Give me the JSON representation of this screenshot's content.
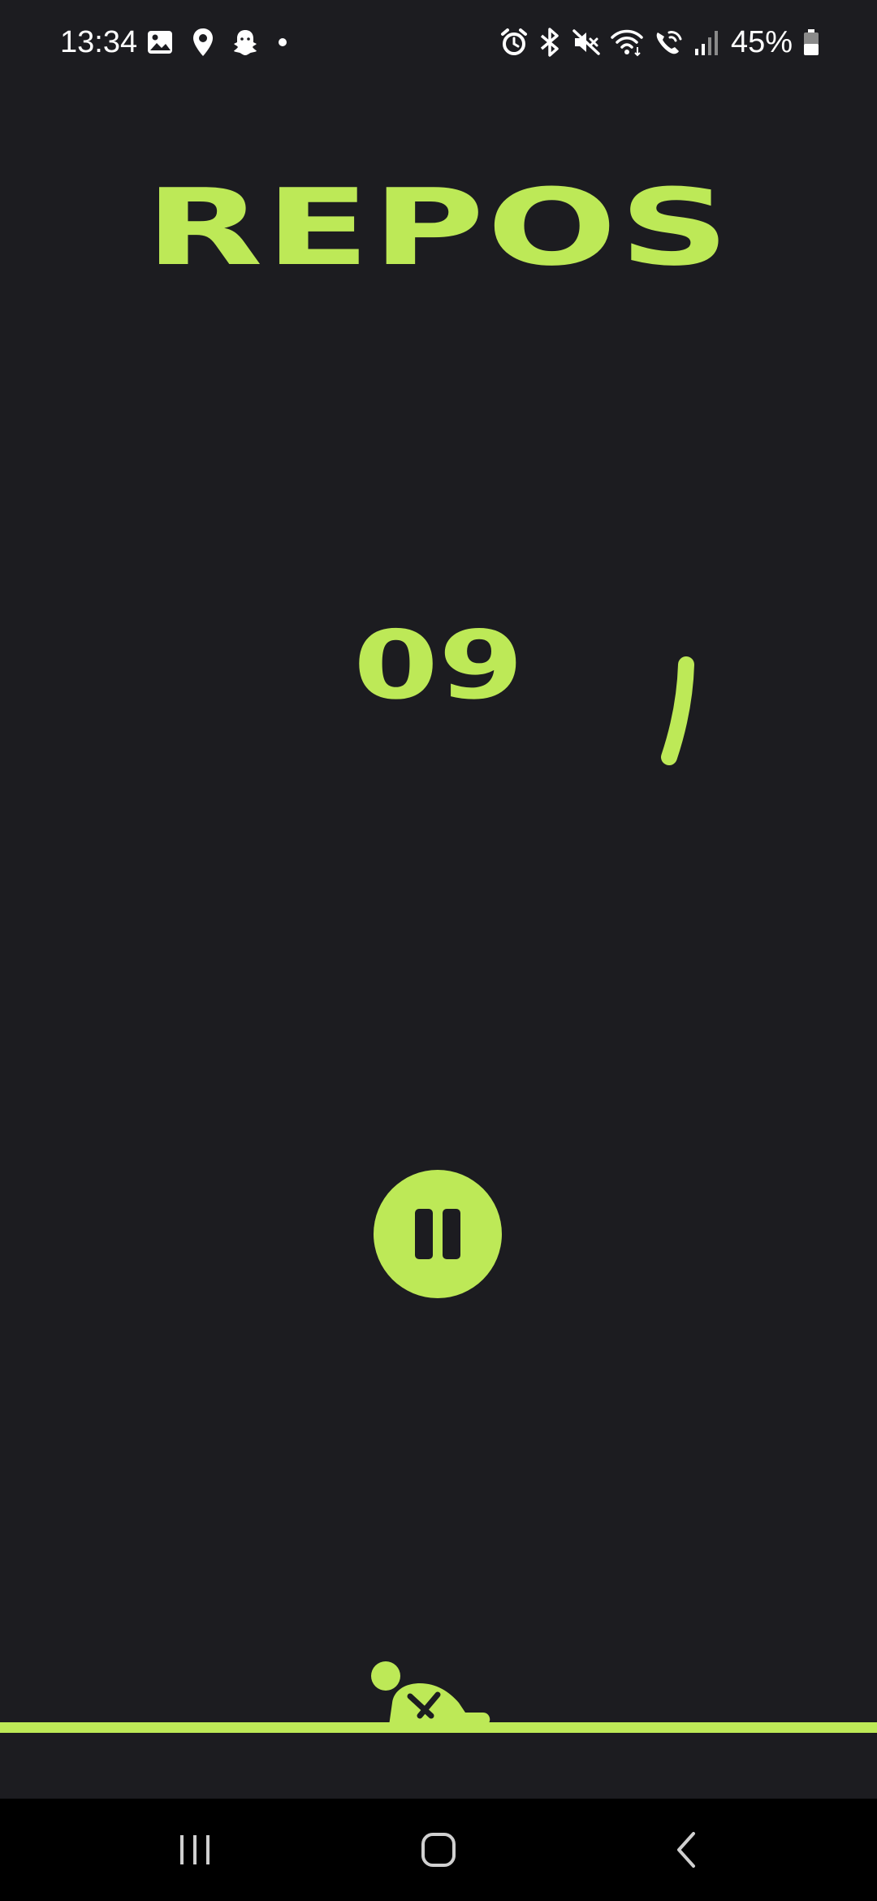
{
  "status_bar": {
    "time": "13:34",
    "left_icons": [
      "gallery-icon",
      "location-pin-icon",
      "snapchat-ghost-icon",
      "notification-dot-icon"
    ],
    "right_icons": [
      "alarm-icon",
      "bluetooth-icon",
      "mute-icon",
      "wifi-icon",
      "wifi-calling-icon",
      "signal-icon"
    ],
    "battery_percent": "45%"
  },
  "screen": {
    "title": "REPOS",
    "countdown": "09",
    "accent_color": "#bde957",
    "background_color": "#1c1c20"
  },
  "controls": {
    "pause_icon": "pause-icon"
  },
  "nav_bar": {
    "buttons": [
      "recents-icon",
      "home-icon",
      "back-icon"
    ]
  }
}
